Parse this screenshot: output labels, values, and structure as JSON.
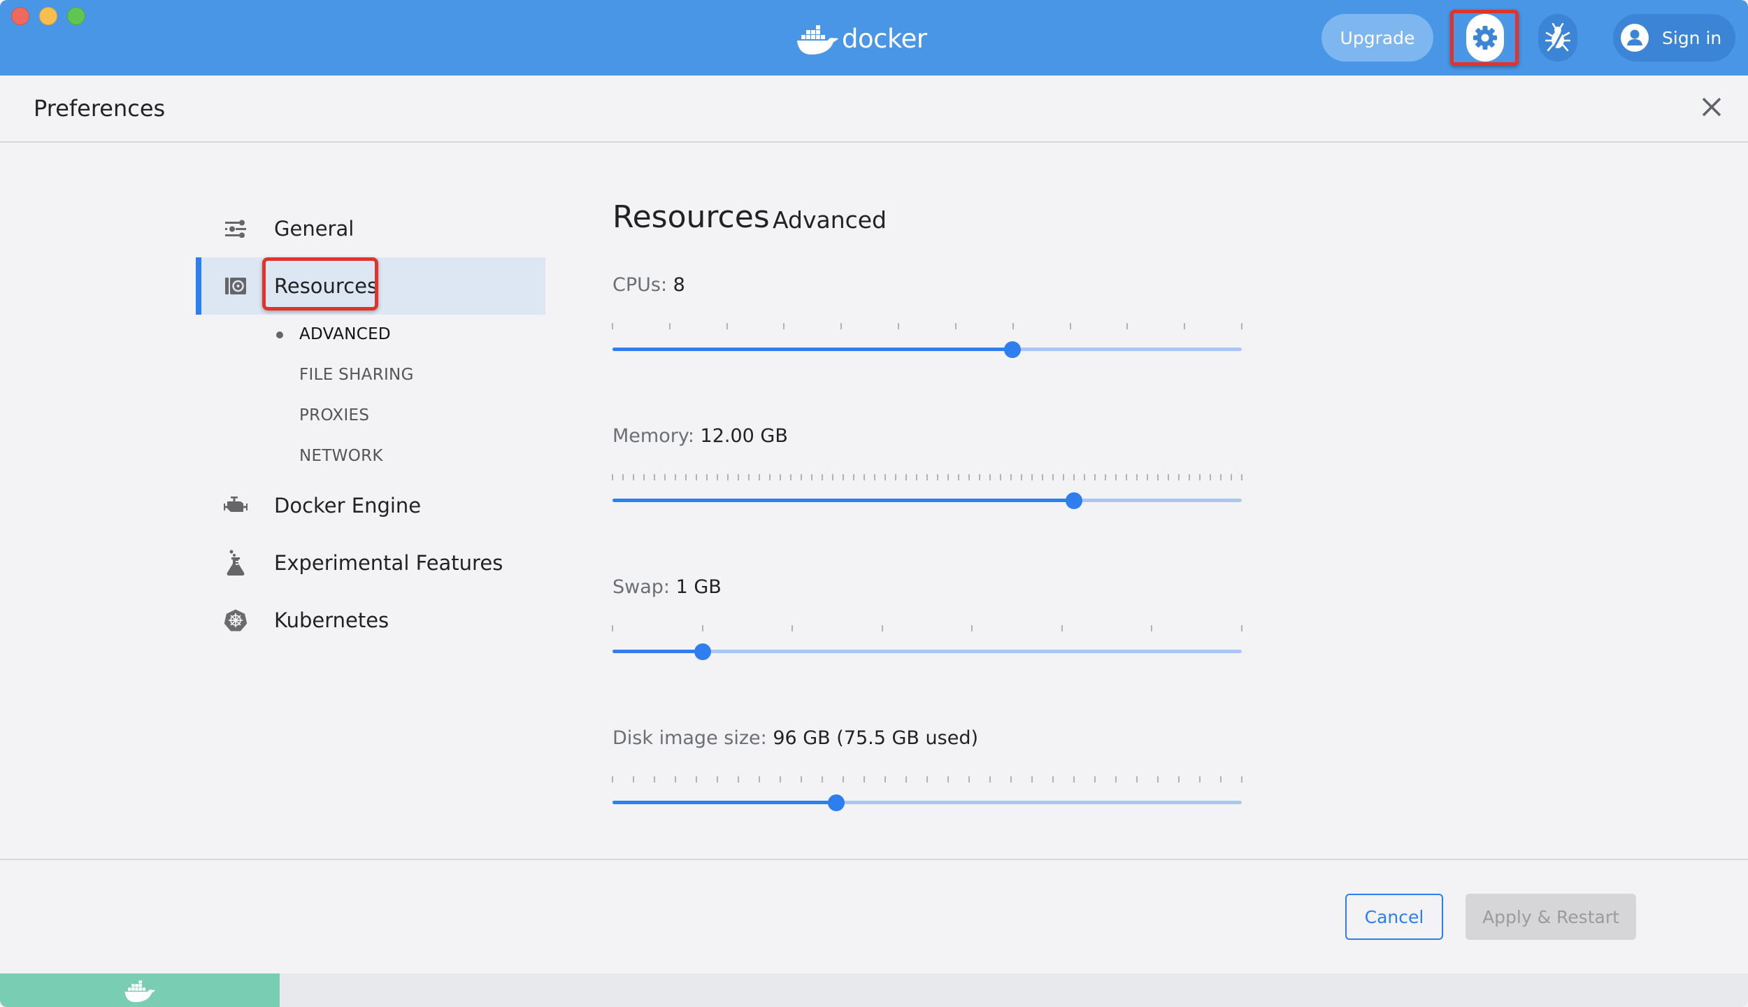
{
  "window": {
    "app_name": "docker",
    "buttons": {
      "upgrade_label": "Upgrade",
      "settings_icon": "gear-icon",
      "troubleshoot_icon": "bug-icon",
      "sign_in_label": "Sign in",
      "sign_in_icon": "user-circle-icon"
    }
  },
  "preferences": {
    "title": "Preferences",
    "close_icon": "close-icon"
  },
  "sidebar": {
    "items": [
      {
        "label": "General",
        "icon": "sliders-icon",
        "selected": false
      },
      {
        "label": "Resources",
        "icon": "resources-icon",
        "selected": true
      },
      {
        "label": "Docker Engine",
        "icon": "engine-icon",
        "selected": false
      },
      {
        "label": "Experimental Features",
        "icon": "flask-icon",
        "selected": false
      },
      {
        "label": "Kubernetes",
        "icon": "kubernetes-icon",
        "selected": false
      }
    ],
    "sub_items": [
      {
        "label": "ADVANCED",
        "active": true
      },
      {
        "label": "FILE SHARING",
        "active": false
      },
      {
        "label": "PROXIES",
        "active": false
      },
      {
        "label": "NETWORK",
        "active": false
      }
    ]
  },
  "main": {
    "title": "Resources",
    "subtitle": "Advanced",
    "sliders": [
      {
        "label": "CPUs:",
        "value_text": "8",
        "min": 1,
        "max": 12,
        "value": 8,
        "tick_count": 12,
        "fraction": 0.636
      },
      {
        "label": "Memory:",
        "value_text": "12.00 GB",
        "min": 1,
        "max": 16,
        "value": 12,
        "tick_count": 61,
        "fraction": 0.733
      },
      {
        "label": "Swap:",
        "value_text": "1 GB",
        "min": 0.5,
        "max": 4,
        "value": 1,
        "tick_count": 8,
        "fraction": 0.143
      },
      {
        "label": "Disk image size:",
        "value_text": "96 GB (75.5 GB used)",
        "value": 96,
        "tick_count": 31,
        "fraction": 0.356
      }
    ]
  },
  "footer": {
    "cancel_label": "Cancel",
    "apply_label": "Apply & Restart",
    "apply_enabled": false
  },
  "statusbar": {
    "engine_icon": "docker-whale-icon",
    "engine_color": "#79cdb2"
  },
  "colors": {
    "titlebar": "#4a96e6",
    "accent": "#2f7ef0",
    "highlight": "#e0342a"
  }
}
